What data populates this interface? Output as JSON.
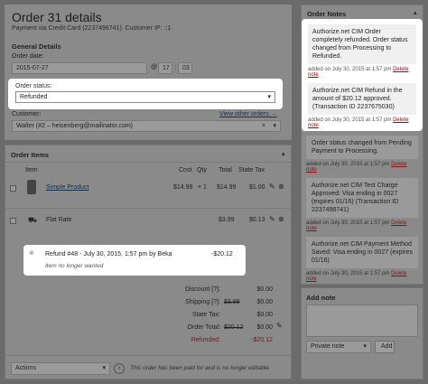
{
  "order": {
    "title": "Order 31 details",
    "subtitle": "Payment via Credit Card (2237498741). Customer IP: ::1",
    "general_heading": "General Details",
    "date_label": "Order date:",
    "date_value": "2015-07-27",
    "date_at": "@",
    "hour": "17",
    "minute": "03",
    "status_label": "Order status:",
    "status_value": "Refunded",
    "customer_label": "Customer:",
    "customer_link": "View other orders →",
    "customer_value": "Walter (#2 – heisenberg@mailinator.com)"
  },
  "items": {
    "heading": "Order Items",
    "columns": {
      "item": "Item",
      "cost": "Cost",
      "qty": "Qty",
      "total": "Total",
      "tax": "State Tax"
    },
    "rows": [
      {
        "name": "Simple Product",
        "cost": "$14.99",
        "qty": "× 1",
        "total": "$14.99",
        "tax": "$1.00"
      },
      {
        "name": "Flat Rate",
        "cost": "",
        "qty": "",
        "total": "$3.99",
        "tax": "$0.13"
      }
    ],
    "refund": {
      "text": "Refund #48 - July 30, 2015, 1:57 pm by Beka",
      "amount": "-$20.12",
      "reason": "Item no longer wanted"
    },
    "totals": [
      {
        "label": "Discount [?]:",
        "value": "$0.00",
        "old": ""
      },
      {
        "label": "Shipping [?]:",
        "value": "$0.00",
        "old": "$3.99"
      },
      {
        "label": "State Tax:",
        "value": "$0.00",
        "old": ""
      },
      {
        "label": "Order Total:",
        "value": "$0.00",
        "old": "$20.12"
      },
      {
        "label": "Refunded:",
        "value": "-$20.12",
        "old": ""
      }
    ],
    "actions_label": "Actions",
    "footer_note": "This order has been paid for and is no longer editable"
  },
  "notes": {
    "heading": "Order Notes",
    "list": [
      {
        "text": "Authorize.net CIM Order completely refunded. Order status changed from Processing to Refunded.",
        "meta": "added on July 30, 2015 at 1:57 pm",
        "delete": "Delete note"
      },
      {
        "text": "Authorize.net CIM Refund in the amount of $20.12 approved. (Transaction ID 2237675030)",
        "meta": "added on July 30, 2015 at 1:57 pm",
        "delete": "Delete note"
      },
      {
        "text": "Order status changed from Pending Payment to Processing.",
        "meta": "added on July 30, 2015 at 1:57 pm",
        "delete": "Delete note"
      },
      {
        "text": "Authorize.net CIM Test Charge Approved: Visa ending in 0027 (expires 01/16) (Transaction ID 2237498741)",
        "meta": "added on July 30, 2015 at 1:57 pm",
        "delete": "Delete note"
      },
      {
        "text": "Authorize.net CIM Payment Method Saved: Visa ending in 0027 (expires 01/16)",
        "meta": "added on July 30, 2015 at 1:57 pm",
        "delete": "Delete note"
      }
    ],
    "add_heading": "Add note",
    "type_value": "Private note",
    "add_button": "Add"
  }
}
